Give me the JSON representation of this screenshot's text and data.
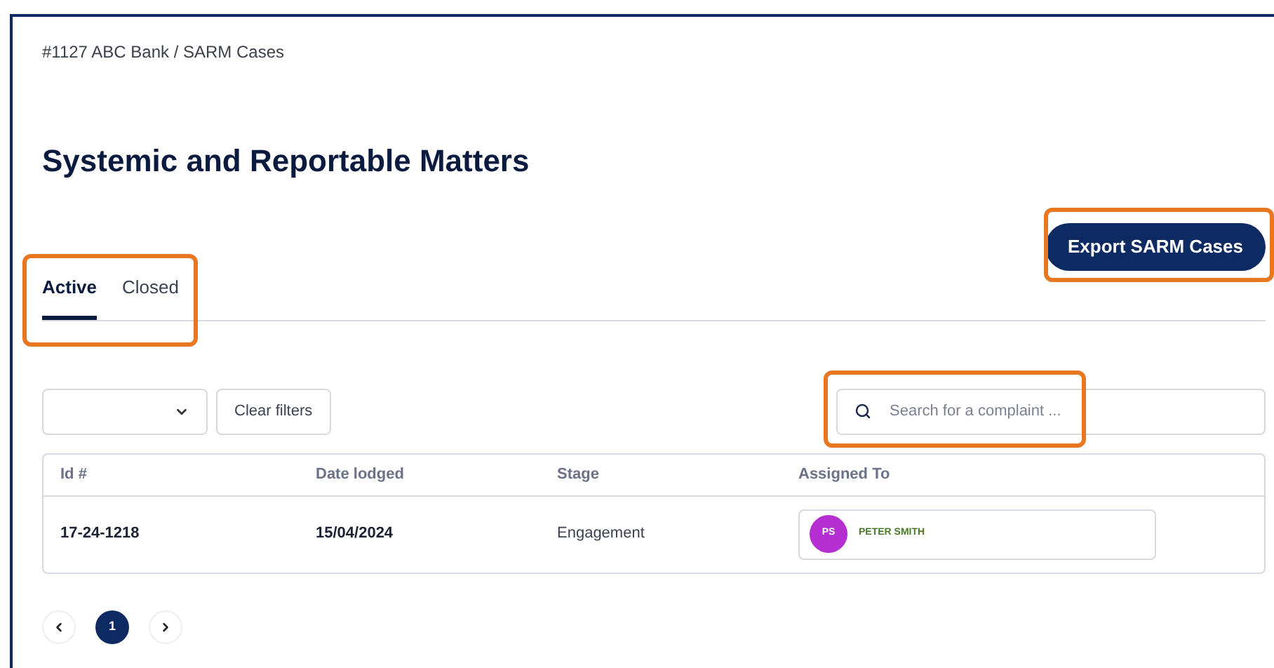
{
  "breadcrumb": "#1127 ABC Bank / SARM Cases",
  "title": "Systemic and Reportable Matters",
  "export_button": "Export SARM Cases",
  "tabs": [
    {
      "label": "Active",
      "selected": true
    },
    {
      "label": "Closed",
      "selected": false
    }
  ],
  "filters": {
    "clear_button": "Clear filters"
  },
  "search": {
    "placeholder": "Search for a complaint ..."
  },
  "table": {
    "columns": [
      "Id #",
      "Date lodged",
      "Stage",
      "Assigned To"
    ],
    "rows": [
      {
        "id": "17-24-1218",
        "date_lodged": "15/04/2024",
        "stage": "Engagement",
        "assignee": {
          "initials": "PS",
          "name": "PETER SMITH",
          "color": "#b52ed1"
        }
      }
    ]
  },
  "pagination": {
    "pages": [
      {
        "label": "1",
        "selected": true
      }
    ]
  }
}
